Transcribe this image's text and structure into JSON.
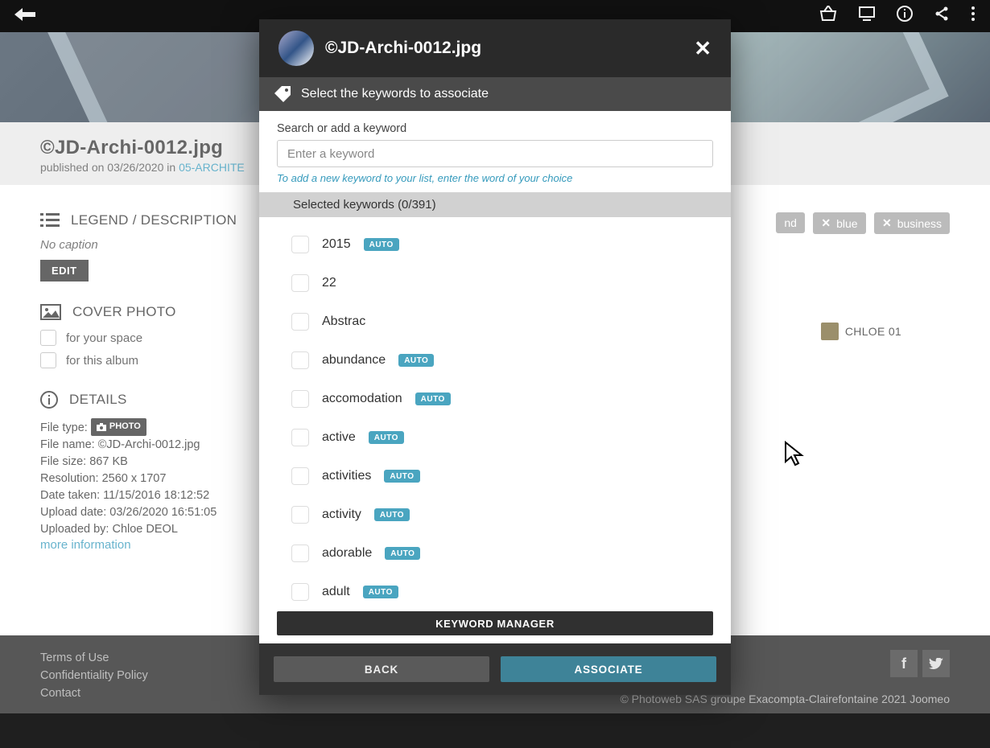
{
  "page": {
    "title": "©JD-Archi-0012.jpg",
    "published_prefix": "published on ",
    "published_date": "03/26/2020",
    "published_in": " in ",
    "album_link": "05-ARCHITE"
  },
  "legend": {
    "heading": "LEGEND / DESCRIPTION",
    "no_caption": "No caption",
    "edit_label": "EDIT"
  },
  "cover": {
    "heading": "COVER PHOTO",
    "opt_space": "for your space",
    "opt_album": "for this album"
  },
  "details": {
    "heading": "DETAILS",
    "file_type_label": "File type: ",
    "file_type_badge": "PHOTO",
    "file_name": "File name: ©JD-Archi-0012.jpg",
    "file_size": "File size: 867 KB",
    "resolution": "Resolution: 2560 x 1707",
    "date_taken": "Date taken: 11/15/2016 18:12:52",
    "upload_date": "Upload date: 03/26/2020 16:51:05",
    "uploaded_by": "Uploaded by: Chloe DEOL",
    "more_info": "more information"
  },
  "right_peek": {
    "tags": [
      "nd",
      "blue",
      "business"
    ],
    "author": "CHLOE 01"
  },
  "footer": {
    "terms": "Terms of Use",
    "conf": "Confidentiality Policy",
    "contact": "Contact",
    "copyright": "© Photoweb SAS groupe Exacompta-Clairefontaine 2021 Joomeo"
  },
  "modal": {
    "title": "©JD-Archi-0012.jpg",
    "subheader": "Select the keywords to associate",
    "search_label": "Search or add a keyword",
    "search_placeholder": "Enter a keyword",
    "hint": "To add a new keyword to your list, enter the word of your choice",
    "selected_label": "Selected keywords (0/391)",
    "auto_badge": "AUTO",
    "kw_manager": "KEYWORD MANAGER",
    "back": "BACK",
    "associate": "ASSOCIATE",
    "keywords": [
      {
        "label": "2015",
        "auto": true
      },
      {
        "label": "22",
        "auto": false
      },
      {
        "label": "Abstrac",
        "auto": false
      },
      {
        "label": "abundance",
        "auto": true
      },
      {
        "label": "accomodation",
        "auto": true
      },
      {
        "label": "active",
        "auto": true
      },
      {
        "label": "activities",
        "auto": true
      },
      {
        "label": "activity",
        "auto": true
      },
      {
        "label": "adorable",
        "auto": true
      },
      {
        "label": "adult",
        "auto": true
      }
    ]
  }
}
